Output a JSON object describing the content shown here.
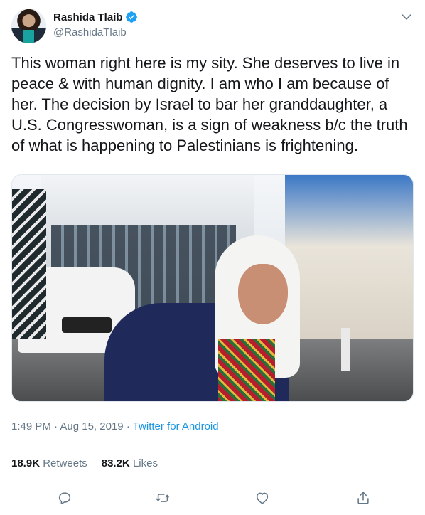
{
  "author": {
    "display_name": "Rashida Tlaib",
    "handle": "@RashidaTlaib",
    "verified": true
  },
  "tweet": {
    "text": "This woman right here is my sity. She deserves to live in peace & with human dignity. I am who I am because of her. The decision by Israel to bar her granddaughter, a U.S. Congresswoman, is a sign of weakness b/c the truth of what is happening to Palestinians is frightening.",
    "time": "1:49 PM",
    "separator": "·",
    "date": "Aug 15, 2019",
    "source": "Twitter for Android"
  },
  "stats": {
    "retweets_count": "18.9K",
    "retweets_label": "Retweets",
    "likes_count": "83.2K",
    "likes_label": "Likes"
  },
  "icons": {
    "verified": "verified-badge-icon",
    "more": "chevron-down-icon",
    "reply": "reply-icon",
    "retweet": "retweet-icon",
    "like": "heart-icon",
    "share": "share-icon"
  },
  "colors": {
    "accent": "#1b95e0",
    "text": "#14171a",
    "muted": "#657786",
    "verified": "#1da1f2"
  }
}
